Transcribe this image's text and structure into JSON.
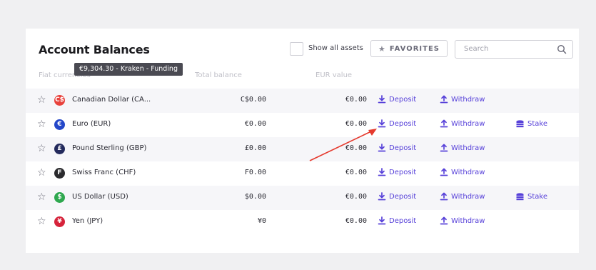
{
  "header": {
    "title": "Account Balances",
    "show_all_label": "Show all assets",
    "favorites_label": "FAVORITES",
    "search_placeholder": "Search"
  },
  "columns": {
    "currency": "Fiat currencies",
    "total": "Total balance",
    "eur": "EUR value"
  },
  "tooltip": "€9,304.30 - Kraken - Funding",
  "actions": {
    "deposit": "Deposit",
    "withdraw": "Withdraw",
    "stake": "Stake"
  },
  "rows": [
    {
      "name": "Canadian Dollar (CA...",
      "icon_symbol": "C$",
      "icon_color": "#e8423c",
      "balance": "C$0.00",
      "eur": "€0.00",
      "stake": false
    },
    {
      "name": "Euro (EUR)",
      "icon_symbol": "€",
      "icon_color": "#2447c9",
      "balance": "€0.00",
      "eur": "€0.00",
      "stake": true
    },
    {
      "name": "Pound Sterling (GBP)",
      "icon_symbol": "£",
      "icon_color": "#232a5c",
      "balance": "£0.00",
      "eur": "€0.00",
      "stake": false
    },
    {
      "name": "Swiss Franc (CHF)",
      "icon_symbol": "F",
      "icon_color": "#2b2b2e",
      "balance": "F0.00",
      "eur": "€0.00",
      "stake": false
    },
    {
      "name": "US Dollar (USD)",
      "icon_symbol": "$",
      "icon_color": "#2fa84f",
      "balance": "$0.00",
      "eur": "€0.00",
      "stake": true
    },
    {
      "name": "Yen (JPY)",
      "icon_symbol": "¥",
      "icon_color": "#d6233b",
      "balance": "¥0",
      "eur": "€0.00",
      "stake": false
    }
  ],
  "colors": {
    "accent": "#5741d9",
    "annotation_arrow": "#e53a2e"
  }
}
